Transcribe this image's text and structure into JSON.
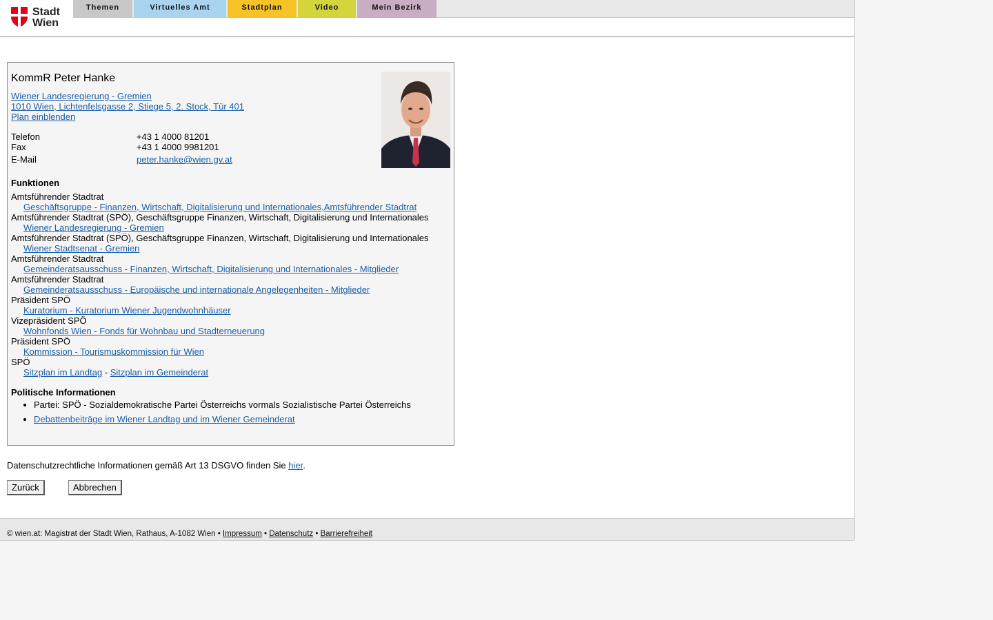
{
  "logo": {
    "line1": "Stadt",
    "line2": "Wien"
  },
  "tabs": [
    {
      "label": "Themen",
      "color": "#c8c8c8"
    },
    {
      "label": "Virtuelles Amt",
      "color": "#a9d4f0"
    },
    {
      "label": "Stadtplan",
      "color": "#f5c228"
    },
    {
      "label": "Video",
      "color": "#d4d43c"
    },
    {
      "label": "Mein Bezirk",
      "color": "#c9aec3"
    }
  ],
  "person": {
    "name": "KommR Peter Hanke",
    "org_link": "Wiener Landesregierung - Gremien ",
    "address_link": "1010 Wien, Lichtenfelsgasse 2, Stiege 5, 2. Stock, Tür 401",
    "plan_link": "Plan einblenden",
    "contact": [
      {
        "label": "Telefon",
        "value": "+43 1 4000 81201"
      },
      {
        "label": "Fax",
        "value": "+43 1 4000 9981201"
      },
      {
        "label": "E-Mail",
        "value": "peter.hanke@wien.gv.at"
      }
    ]
  },
  "functions_heading": "Funktionen",
  "functions": [
    {
      "role": "Amtsführender Stadtrat",
      "link": "Geschäftsgruppe - Finanzen, Wirtschaft, Digitalisierung und Internationales,Amtsführender Stadtrat"
    },
    {
      "role": "Amtsführender Stadtrat (SPÖ), Geschäftsgruppe Finanzen, Wirtschaft, Digitalisierung und Internationales",
      "link": "Wiener Landesregierung - Gremien"
    },
    {
      "role": "Amtsführender Stadtrat (SPÖ), Geschäftsgruppe Finanzen, Wirtschaft, Digitalisierung und Internationales",
      "link": "Wiener Stadtsenat - Gremien"
    },
    {
      "role": "Amtsführender Stadtrat",
      "link": "Gemeinderatsausschuss - Finanzen, Wirtschaft, Digitalisierung und Internationales - Mitglieder"
    },
    {
      "role": "Amtsführender Stadtrat",
      "link": "Gemeinderatsausschuss - Europäische und internationale Angelegenheiten - Mitglieder"
    },
    {
      "role": "Präsident SPÖ",
      "link": "Kuratorium - Kuratorium Wiener Jugendwohnhäuser"
    },
    {
      "role": "Vizepräsident SPÖ",
      "link": "Wohnfonds Wien - Fonds für Wohnbau und Stadterneuerung"
    },
    {
      "role": "Präsident SPÖ",
      "link": "Kommission - Tourismuskommission für Wien"
    }
  ],
  "party_row": {
    "role": "SPÖ",
    "link1": "Sitzplan im Landtag",
    "separator": " - ",
    "link2": "Sitzplan im Gemeinderat"
  },
  "political_heading": "Politische Informationen",
  "political": {
    "party": "Partei: SPÖ - Sozialdemokratische Partei Österreichs vormals Sozialistische Partei Österreichs",
    "debate_link": "Debattenbeiträge im Wiener Landtag und im Wiener Gemeinderat"
  },
  "privacy": {
    "text": "Datenschutzrechtliche Informationen gemäß Art 13 DSGVO finden Sie ",
    "link": "hier",
    "end": "."
  },
  "buttons": {
    "back": "Zurück",
    "cancel": "Abbrechen"
  },
  "footer": {
    "text": "© wien.at: Magistrat der Stadt Wien, Rathaus, A-1082 Wien • ",
    "impressum": "Impressum",
    "sep": " • ",
    "datenschutz": "Datenschutz",
    "barrierefreiheit": "Barrierefreiheit"
  }
}
